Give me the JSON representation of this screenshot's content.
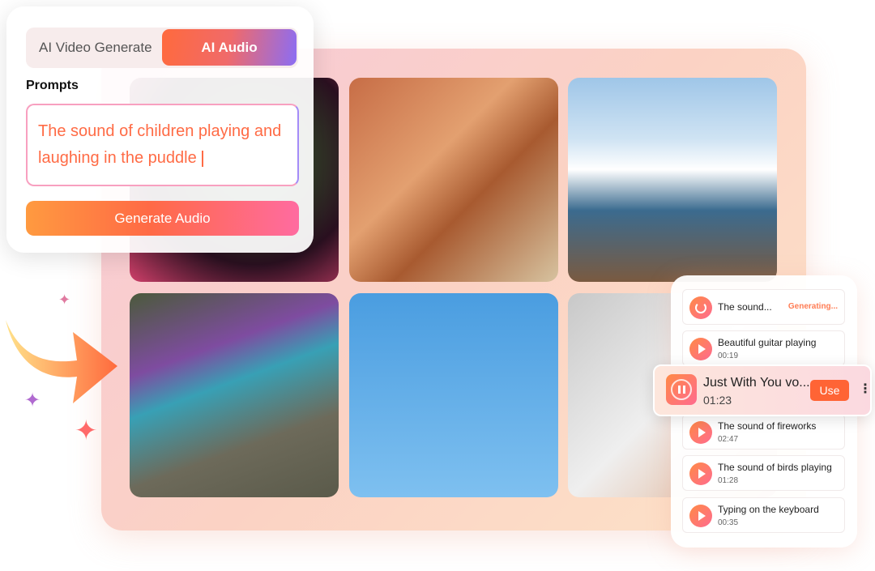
{
  "tabs": {
    "video": "AI Video Generate",
    "audio": "AI Audio"
  },
  "prompts": {
    "label": "Prompts",
    "text": "The sound of children playing and laughing in the puddle"
  },
  "generate_button": "Generate Audio",
  "gallery": [
    "fireworks",
    "guitar",
    "ocean-waves",
    "child-umbrella-rain",
    "bird-on-branch",
    "keyboard-typing"
  ],
  "audio_list": {
    "generating": {
      "title": "The sound...",
      "status": "Generating..."
    },
    "items": [
      {
        "title": "Beautiful guitar playing",
        "duration": "00:19"
      },
      {
        "title": "The sound of fireworks",
        "duration": "02:47"
      },
      {
        "title": "The sound of birds playing",
        "duration": "01:28"
      },
      {
        "title": "Typing on the keyboard",
        "duration": "00:35"
      }
    ],
    "playing": {
      "title": "Just With You vo...",
      "duration": "01:23",
      "use": "Use"
    }
  },
  "colors": {
    "accent": "#ff6435",
    "purple": "#8b6df4"
  }
}
